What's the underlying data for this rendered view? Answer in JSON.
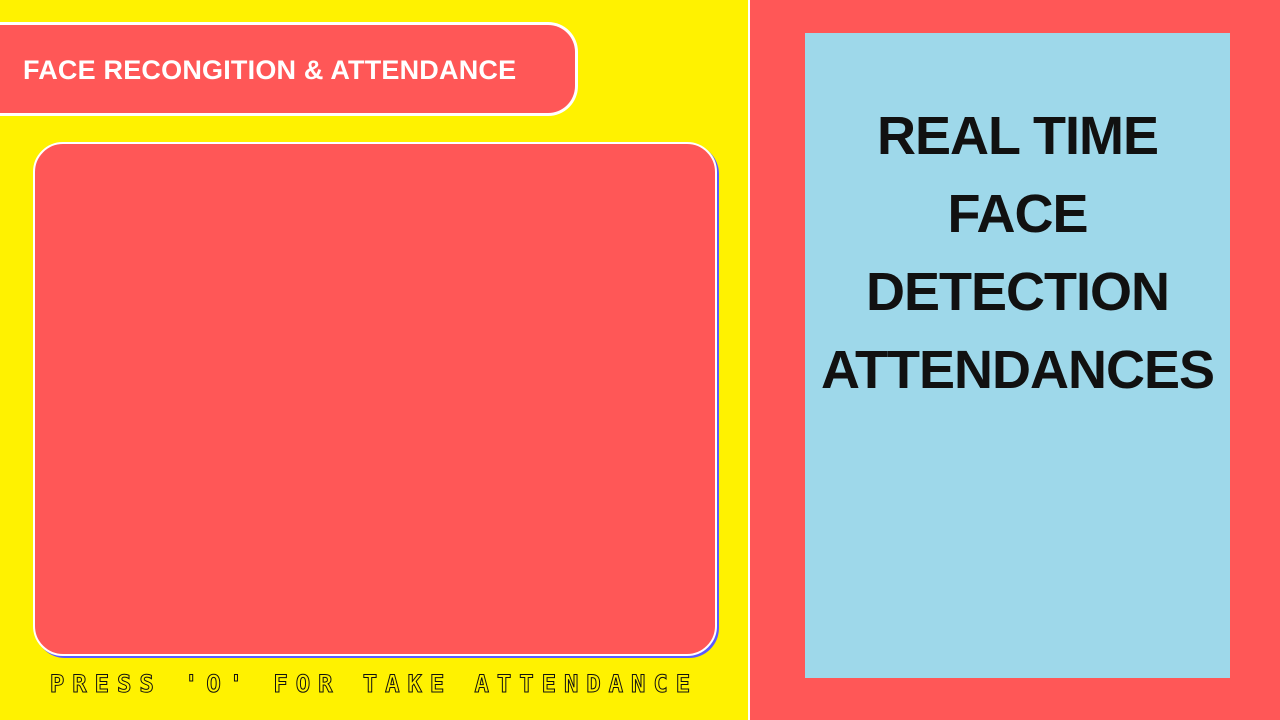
{
  "header": {
    "title": "FACE RECONGITION & ATTENDANCE"
  },
  "camera": {
    "hint": "PRESS 'O' FOR TAKE ATTENDANCE"
  },
  "info_card": {
    "lines": [
      "REAL TIME",
      "FACE",
      "DETECTION",
      "ATTENDANCES"
    ]
  },
  "colors": {
    "background_left": "#fff200",
    "panel_red": "#ff5757",
    "card_blue": "#9ed8ea",
    "text_dark": "#111111",
    "text_light": "#ffffff"
  }
}
